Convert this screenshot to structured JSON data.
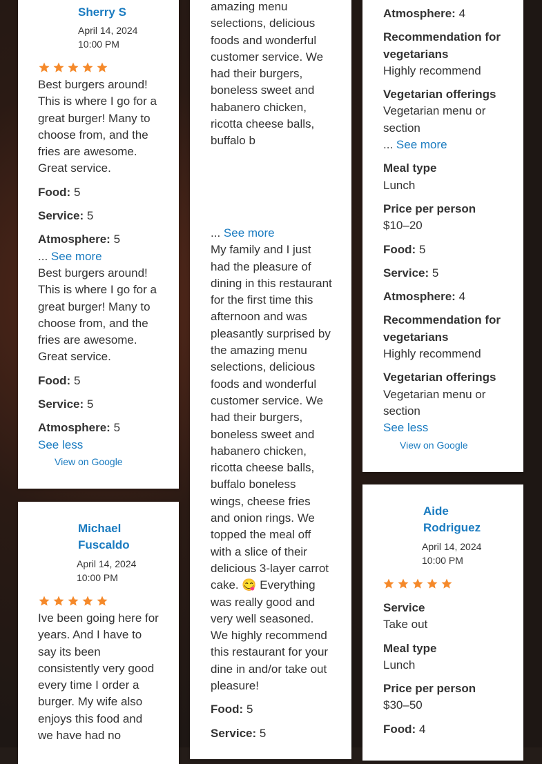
{
  "reviews": {
    "sherry": {
      "name": "Sherry S",
      "date": "April 14, 2024",
      "time": "10:00 PM",
      "rating": 5,
      "text": "Best burgers around! This is where I go for a great burger! Many to choose from, and the fries are awesome. Great service.",
      "food_label": "Food:",
      "food": "5",
      "service_label": "Service:",
      "service": "5",
      "atmosphere_label": "Atmosphere:",
      "atmosphere": "5",
      "ellipsis": "...",
      "see_more": "See more",
      "full_text": "Best burgers around! This is where I go for a great burger! Many to choose from, and the fries are awesome. Great service.",
      "see_less": "See less",
      "view_on_google": "View on Google"
    },
    "michael": {
      "name_line1": "Michael",
      "name_line2": "Fuscaldo",
      "date": "April 14, 2024",
      "time": "10:00 PM",
      "rating": 5,
      "text": "Ive been going here for years. And I have to say its been consistently very good every time I order a burger. My wife also enjoys this food and we have had no"
    },
    "middle": {
      "truncated_text": "amazing menu selections, delicious foods and wonderful customer service. We had their burgers, boneless sweet and habanero chicken, ricotta cheese balls, buffalo b",
      "ellipsis": "...",
      "see_more": "See more",
      "full_text": "My family and I just had the pleasure of dining in this restaurant for the first time this afternoon and was pleasantly surprised by the amazing menu selections, delicious foods and wonderful customer service. We had their burgers, boneless sweet and habanero chicken, ricotta cheese balls, buffalo boneless wings, cheese fries and onion rings. We topped the meal off with a slice of their delicious 3-layer carrot cake. 😋 Everything was really good and very well seasoned. We highly recommend this restaurant for your dine in and/or take out pleasure!",
      "food_label": "Food:",
      "food": "5",
      "service_label": "Service:",
      "service": "5"
    },
    "right": {
      "atmosphere_label": "Atmosphere:",
      "atmosphere": "4",
      "rec_label": "Recommendation for vegetarians",
      "rec_value": "Highly recommend",
      "veg_label": "Vegetarian offerings",
      "veg_value": "Vegetarian menu or section",
      "ellipsis": "...",
      "see_more": "See more",
      "meal_label": "Meal type",
      "meal_value": "Lunch",
      "price_label": "Price per person",
      "price_value": "$10–20",
      "food_label": "Food:",
      "food": "5",
      "service_label": "Service:",
      "service": "5",
      "atmosphere2": "4",
      "rec_value2": "Highly recommend",
      "veg_value2": "Vegetarian menu or section",
      "see_less": "See less",
      "view_on_google": "View on Google"
    },
    "aide": {
      "name_line1": "Aide",
      "name_line2": "Rodriguez",
      "date": "April 14, 2024",
      "time": "10:00 PM",
      "rating": 5,
      "service_label": "Service",
      "service_value": "Take out",
      "meal_label": "Meal type",
      "meal_value": "Lunch",
      "price_label": "Price per person",
      "price_value": "$30–50",
      "food_label": "Food:",
      "food": "4"
    }
  },
  "colors": {
    "star": "#f5892a",
    "link": "#1a7bc0",
    "text": "#333333"
  }
}
